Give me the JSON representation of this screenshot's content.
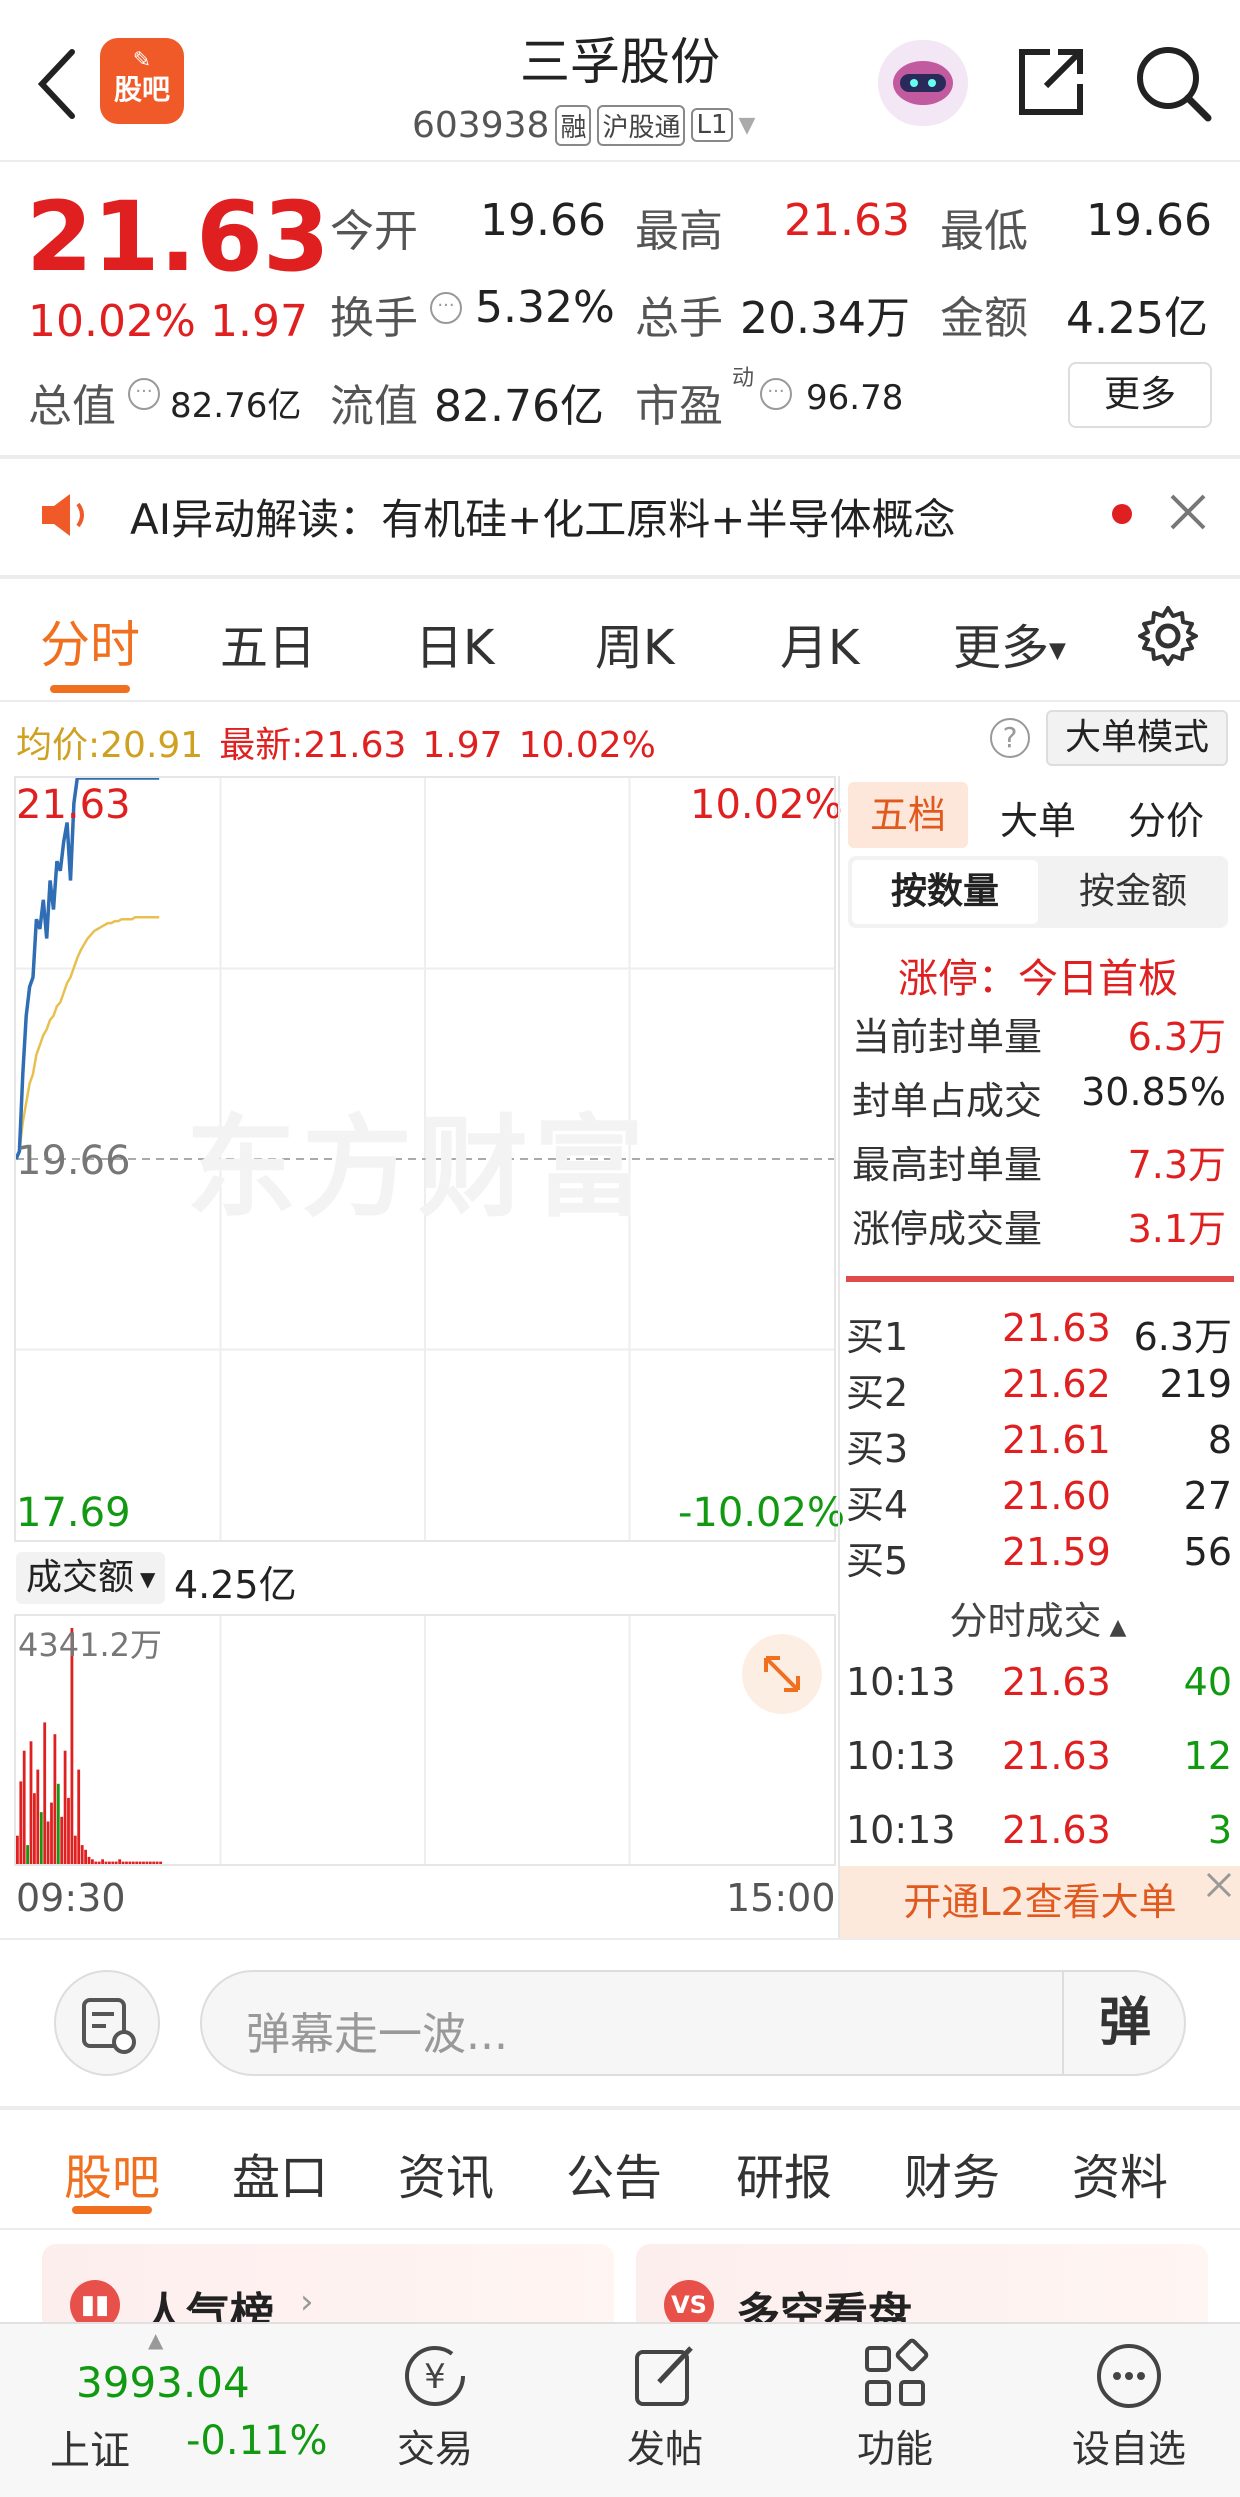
{
  "colors": {
    "up": "#e02020",
    "down": "#119911",
    "accent": "#f07020",
    "line": "#2f6db4",
    "avg": "#e8c050"
  },
  "header": {
    "stock_name": "三孚股份",
    "code": "603938",
    "badge_rong": "融",
    "badge_hgt": "沪股通",
    "badge_level": "L1",
    "logo_text": "股吧"
  },
  "quote": {
    "price": "21.63",
    "pct": "10.02%",
    "chg": "1.97",
    "labels": {
      "open": "今开",
      "high": "最高",
      "low": "最低",
      "turnover": "换手",
      "volume": "总手",
      "amount": "金额",
      "mktcap": "总值",
      "float": "流值",
      "pe": "市盈",
      "pe_sup": "动"
    },
    "open": "19.66",
    "high": "21.63",
    "low": "19.66",
    "turnover": "5.32%",
    "volume": "20.34万",
    "amount": "4.25亿",
    "mktcap": "82.76亿",
    "float": "82.76亿",
    "pe": "96.78",
    "more": "更多"
  },
  "ai_banner": {
    "text": "AI异动解读：有机硅+化工原料+半导体概念"
  },
  "tabs": [
    "分时",
    "五日",
    "日K",
    "周K",
    "月K",
    "更多"
  ],
  "info_bar": {
    "avg_label": "均价:",
    "avg": "20.91",
    "latest_label": "最新:",
    "latest": "21.63",
    "chg": "1.97",
    "pct": "10.02%",
    "mode_btn": "大单模式"
  },
  "chart": {
    "y_top": "21.63",
    "y_mid": "19.66",
    "y_bot": "17.69",
    "pct_top": "10.02%",
    "pct_bot": "-10.02%",
    "watermark": "东方财富",
    "vol_select": "成交额",
    "vol_value": "4.25亿",
    "vol_max": "4341.2万",
    "time_start": "09:30",
    "time_end": "15:00"
  },
  "chart_data": {
    "type": "line",
    "series": [
      {
        "values": [
          19.66,
          19.7,
          20.1,
          20.4,
          20.55,
          20.6,
          20.9,
          20.85,
          21.0,
          20.8,
          21.1,
          20.95,
          21.2,
          21.15,
          21.3,
          21.4,
          21.1,
          21.5,
          21.63,
          21.63,
          21.63,
          21.63,
          21.63,
          21.63,
          21.63,
          21.63,
          21.63,
          21.63,
          21.63,
          21.63,
          21.63,
          21.63,
          21.63,
          21.63,
          21.63,
          21.63,
          21.63,
          21.63,
          21.63,
          21.63,
          21.63,
          21.63,
          21.63
        ]
      },
      {
        "values": [
          19.66,
          19.7,
          19.85,
          19.95,
          20.05,
          20.1,
          20.2,
          20.25,
          20.3,
          20.33,
          20.38,
          20.4,
          20.45,
          20.47,
          20.52,
          20.57,
          20.6,
          20.65,
          20.7,
          20.74,
          20.77,
          20.8,
          20.82,
          20.84,
          20.85,
          20.86,
          20.87,
          20.88,
          20.88,
          20.89,
          20.89,
          20.9,
          20.9,
          20.9,
          20.9,
          20.91,
          20.91,
          20.91,
          20.91,
          20.91,
          20.91,
          20.91,
          20.91
        ]
      }
    ],
    "ylim": [
      17.69,
      21.63
    ],
    "volume": [
      12,
      35,
      48,
      8,
      52,
      30,
      40,
      22,
      60,
      18,
      26,
      55,
      34,
      20,
      48,
      28,
      100,
      12,
      40,
      8,
      6,
      3,
      2,
      1,
      1,
      2,
      1,
      1,
      1,
      1,
      2,
      1,
      1,
      1,
      1,
      1,
      1,
      1,
      1,
      1,
      1,
      1,
      1
    ],
    "volume_colors_up": [
      1,
      1,
      1,
      0,
      1,
      1,
      1,
      0,
      1,
      1,
      1,
      1,
      0,
      1,
      1,
      1,
      1,
      1,
      1,
      1,
      1,
      1,
      1,
      1,
      1,
      1,
      1,
      1,
      1,
      1,
      1,
      1,
      1,
      1,
      1,
      1,
      1,
      1,
      1,
      1,
      1,
      1,
      1
    ]
  },
  "side": {
    "tabs": [
      "五档",
      "大单",
      "分价"
    ],
    "sub_tabs": [
      "按数量",
      "按金额"
    ],
    "limit_title": "涨停：今日首板",
    "limit_rows": [
      {
        "label": "当前封单量",
        "value": "6.3万",
        "red": true
      },
      {
        "label": "封单占成交",
        "value": "30.85%",
        "red": false
      },
      {
        "label": "最高封单量",
        "value": "7.3万",
        "red": true
      },
      {
        "label": "涨停成交量",
        "value": "3.1万",
        "red": true
      }
    ],
    "bids": [
      {
        "label": "买1",
        "price": "21.63",
        "vol": "6.3万"
      },
      {
        "label": "买2",
        "price": "21.62",
        "vol": "219"
      },
      {
        "label": "买3",
        "price": "21.61",
        "vol": "8"
      },
      {
        "label": "买4",
        "price": "21.60",
        "vol": "27"
      },
      {
        "label": "买5",
        "price": "21.59",
        "vol": "56"
      }
    ],
    "ticks_title": "分时成交",
    "ticks": [
      {
        "time": "10:13",
        "price": "21.63",
        "vol": "40"
      },
      {
        "time": "10:13",
        "price": "21.63",
        "vol": "12"
      },
      {
        "time": "10:13",
        "price": "21.63",
        "vol": "3"
      }
    ],
    "l2_banner": "开通L2查看大单"
  },
  "danmu": {
    "placeholder": "弹幕走一波...",
    "btn": "弹"
  },
  "bottom_tabs": [
    "股吧",
    "盘口",
    "资讯",
    "公告",
    "研报",
    "财务",
    "资料"
  ],
  "cards": [
    {
      "title": "人气榜"
    },
    {
      "title": "多空看盘"
    }
  ],
  "footer": {
    "index_value": "3993.04",
    "index_name": "上证",
    "index_pct": "-0.11%",
    "items": [
      "交易",
      "发帖",
      "功能",
      "设自选"
    ]
  }
}
